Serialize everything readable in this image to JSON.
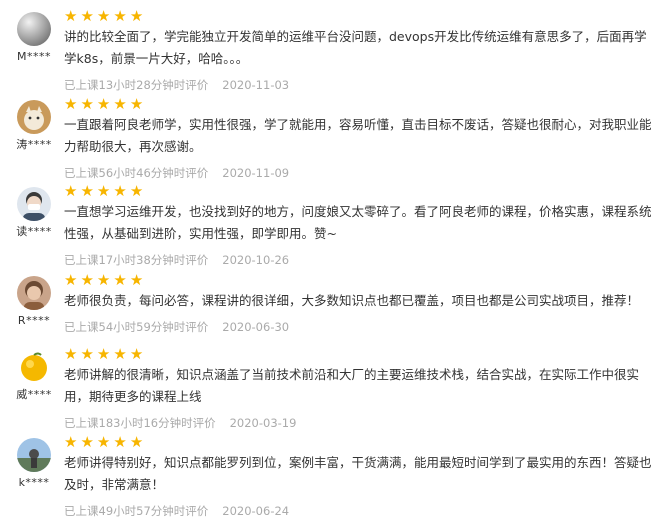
{
  "reviews": [
    {
      "avatar": "gradient-gray-avatar",
      "user": "M****",
      "rating": 5,
      "text": "讲的比较全面了，学完能独立开发简单的运维平台没问题，devops开发比传统运维有意思多了，后面再学学k8s，前景一片大好，哈哈。。。",
      "duration": "已上课13小时28分钟时评价",
      "date": "2020-11-03"
    },
    {
      "avatar": "cat-photo-avatar",
      "user": "涛****",
      "rating": 5,
      "text": "一直跟着阿良老师学，实用性很强，学了就能用，容易听懂，直击目标不废话，答疑也很耐心，对我职业能力帮助很大，再次感谢。",
      "duration": "已上课56小时46分钟时评价",
      "date": "2020-11-09"
    },
    {
      "avatar": "masked-person-avatar",
      "user": "读****",
      "rating": 5,
      "text": "一直想学习运维开发，也没找到好的地方，问度娘又太零碎了。看了阿良老师的课程，价格实惠，课程系统性强，从基础到进阶，实用性强，即学即用。赞~",
      "duration": "已上课17小时38分钟时评价",
      "date": "2020-10-26"
    },
    {
      "avatar": "child-portrait-avatar",
      "user": "R****",
      "rating": 5,
      "text": "老师很负责，每问必答，课程讲的很详细，大多数知识点也都已覆盖，项目也都是公司实战项目，推荐！",
      "duration": "已上课54小时59分钟时评价",
      "date": "2020-06-30"
    },
    {
      "avatar": "yellow-fruit-avatar",
      "user": "威****",
      "rating": 5,
      "text": "老师讲解的很清晰，知识点涵盖了当前技术前沿和大厂的主要运维技术栈，结合实战，在实际工作中很实用，期待更多的课程上线",
      "duration": "已上课183小时16分钟时评价",
      "date": "2020-03-19"
    },
    {
      "avatar": "landscape-avatar",
      "user": "k****",
      "rating": 5,
      "text": "老师讲得特别好，知识点都能罗列到位，案例丰富，干货满满，能用最短时间学到了最实用的东西！答疑也及时，非常满意！",
      "duration": "已上课49小时57分钟时评价",
      "date": "2020-06-24"
    }
  ]
}
